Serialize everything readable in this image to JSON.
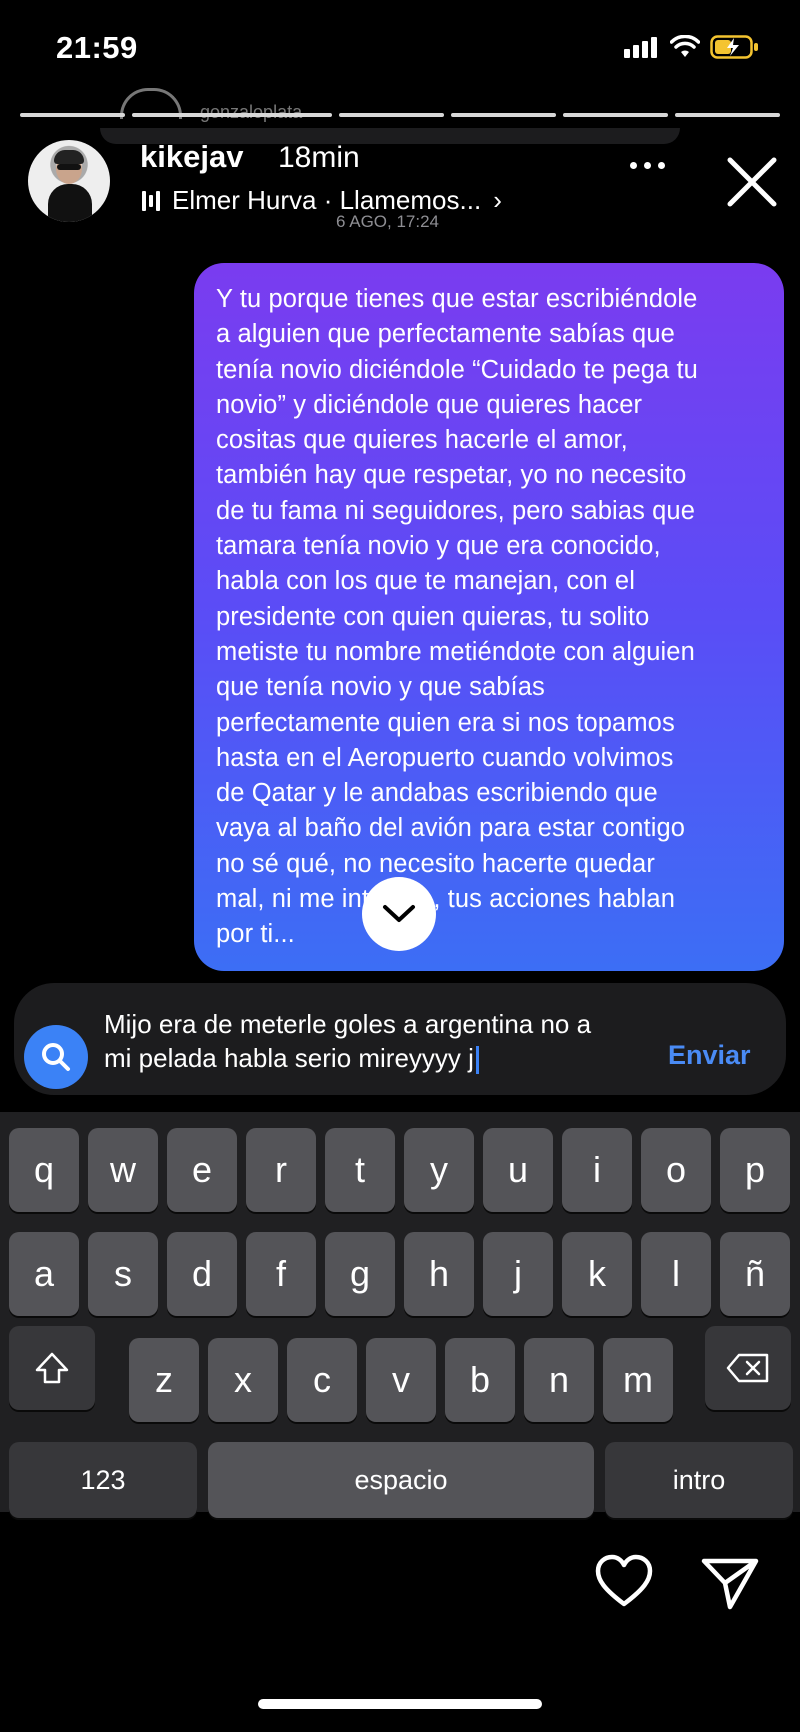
{
  "status_bar": {
    "time": "21:59"
  },
  "ghost": {
    "username": "gonzaloplata"
  },
  "header": {
    "username": "kikejav",
    "age": "18min",
    "music": "Elmer Hurva · Llamemos...",
    "timestamp": "6 AGO, 17:24"
  },
  "message": {
    "text": "Y tu porque tienes que estar escribiéndole\na alguien que perfectamente sabías que\ntenía novio diciéndole “Cuidado te pega tu\nnovio” y diciéndole que quieres hacer\ncositas que quieres hacerle el amor,\ntambién hay que respetar, yo no necesito\nde tu fama ni seguidores, pero sabias que\ntamara tenía novio y que era conocido,\nhabla con los que te manejan, con el\npresidente con quien quieras, tu solito\nmetiste tu nombre metiéndote con alguien\nque tenía novio y que sabías\nperfectamente quien era si nos topamos\nhasta en el Aeropuerto cuando volvimos\nde Qatar y le andabas escribiendo que\nvaya al baño del avión para estar contigo\nno sé qué, no necesito hacerte quedar\nmal, ni me interesa, tus acciones hablan\npor ti..."
  },
  "reply": {
    "line1": "Mijo era de meterle goles a argentina no a",
    "line2": "mi pelada habla serio mireyyyy j",
    "send_label": "Enviar"
  },
  "keyboard": {
    "row1": [
      "q",
      "w",
      "e",
      "r",
      "t",
      "y",
      "u",
      "i",
      "o",
      "p"
    ],
    "row2": [
      "a",
      "s",
      "d",
      "f",
      "g",
      "h",
      "j",
      "k",
      "l",
      "ñ"
    ],
    "row3": [
      "z",
      "x",
      "c",
      "v",
      "b",
      "n",
      "m"
    ],
    "numbers_label": "123",
    "space_label": "espacio",
    "return_label": "intro"
  },
  "colors": {
    "accent": "#3b82f6",
    "bubble_top": "#7a3cf0",
    "bubble_bottom": "#3c6ef5"
  }
}
